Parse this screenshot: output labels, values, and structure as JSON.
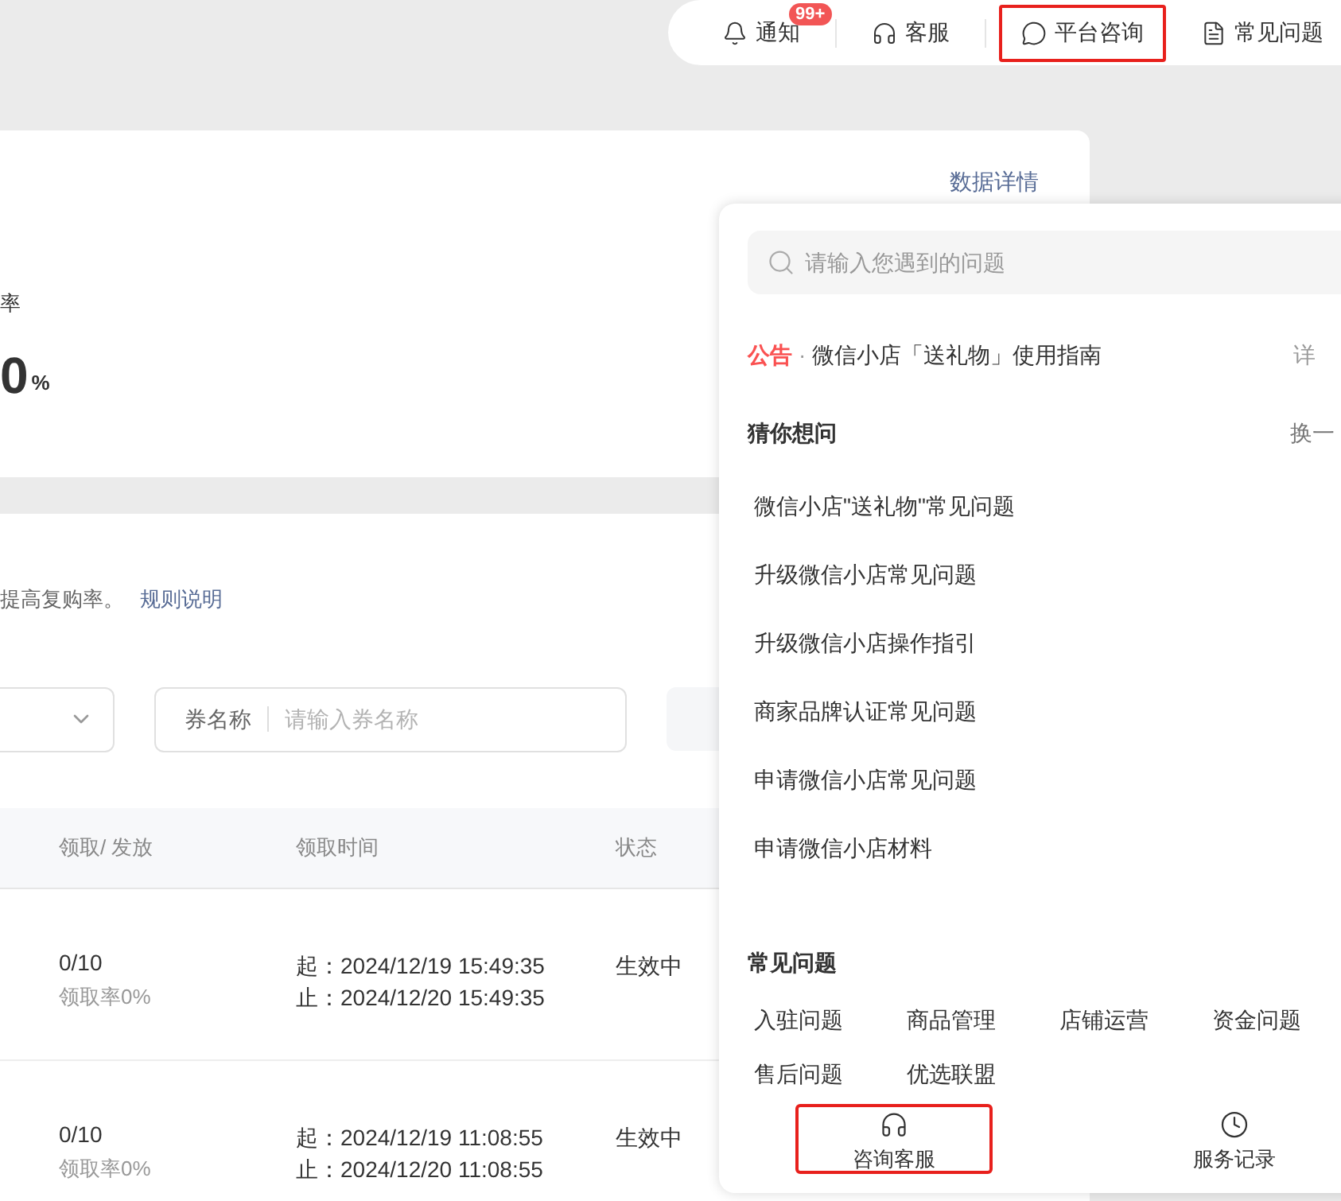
{
  "topbar": {
    "items": [
      {
        "kind": "bell",
        "label": "通知",
        "badge": "99+",
        "highlighted": false
      },
      {
        "kind": "headset",
        "label": "客服",
        "highlighted": false
      },
      {
        "kind": "chat",
        "label": "平台咨询",
        "highlighted": true
      },
      {
        "kind": "doc",
        "label": "常见问题",
        "highlighted": false
      }
    ]
  },
  "stats": {
    "link": "数据详情",
    "label": "率",
    "value": "0",
    "unit": "%"
  },
  "intro": {
    "text": "提高复购率。",
    "link": "规则说明"
  },
  "filters": {
    "name_label": "券名称",
    "name_placeholder": "请输入券名称"
  },
  "table": {
    "columns": [
      "领取/ 发放",
      "领取时间",
      "状态"
    ],
    "rows": [
      {
        "count": "0/10",
        "rate": "领取率0%",
        "start": "起：2024/12/19 15:49:35",
        "end": "止：2024/12/20 15:49:35",
        "status": "生效中"
      },
      {
        "count": "0/10",
        "rate": "领取率0%",
        "start": "起：2024/12/19 11:08:55",
        "end": "止：2024/12/20 11:08:55",
        "status": "生效中"
      }
    ]
  },
  "popup": {
    "search_placeholder": "请输入您遇到的问题",
    "notice": {
      "tag": "公告",
      "dot": "·",
      "text": "微信小店「送礼物」使用指南",
      "more": "详"
    },
    "guess": {
      "title": "猜你想问",
      "refresh": "换一",
      "items": [
        "微信小店\"送礼物\"常见问题",
        "升级微信小店常见问题",
        "升级微信小店操作指引",
        "商家品牌认证常见问题",
        "申请微信小店常见问题",
        "申请微信小店材料"
      ]
    },
    "faq": {
      "title": "常见问题",
      "items": [
        "入驻问题",
        "商品管理",
        "店铺运营",
        "资金问题",
        "售后问题",
        "优选联盟"
      ]
    },
    "actions": [
      {
        "kind": "headset",
        "label": "咨询客服",
        "highlighted": true
      },
      {
        "kind": "clock",
        "label": "服务记录",
        "highlighted": false
      }
    ]
  }
}
